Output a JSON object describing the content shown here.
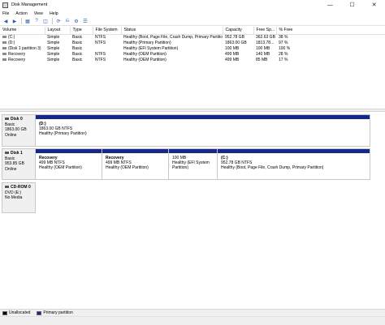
{
  "window": {
    "title": "Disk Management",
    "minimize": "—",
    "maximize": "☐",
    "close": "✕"
  },
  "menu": [
    "File",
    "Action",
    "View",
    "Help"
  ],
  "toolbar": [
    "back-icon",
    "forward-icon",
    "volume-list-icon",
    "help-icon",
    "disk-properties-icon",
    "refresh-icon",
    "rescan-icon",
    "settings-icon",
    "properties-icon"
  ],
  "table": {
    "headers": [
      "Volume",
      "Layout",
      "Type",
      "File System",
      "Status",
      "Capacity",
      "Free Sp...",
      "% Free"
    ],
    "rows": [
      [
        "(C:)",
        "Simple",
        "Basic",
        "NTFS",
        "Healthy (Boot, Page File, Crash Dump, Primary Partition)",
        "952.78 GB",
        "362.63 GB",
        "38 %"
      ],
      [
        "(D:)",
        "Simple",
        "Basic",
        "NTFS",
        "Healthy (Primary Partition)",
        "1863.00 GB",
        "1813.78...",
        "97 %"
      ],
      [
        "(Disk 1 partition 3)",
        "Simple",
        "Basic",
        "",
        "Healthy (EFI System Partition)",
        "100 MB",
        "100 MB",
        "100 %"
      ],
      [
        "Recovery",
        "Simple",
        "Basic",
        "NTFS",
        "Healthy (OEM Partition)",
        "499 MB",
        "140 MB",
        "28 %"
      ],
      [
        "Recovery",
        "Simple",
        "Basic",
        "NTFS",
        "Healthy (OEM Partition)",
        "499 MB",
        "85 MB",
        "17 %"
      ]
    ]
  },
  "disks": [
    {
      "name": "Disk 0",
      "type": "Basic",
      "size": "1863.00 GB",
      "status": "Online",
      "partitions": [
        {
          "name": "(D:)",
          "line1": "1863.00 GB NTFS",
          "line2": "Healthy (Primary Partition)"
        }
      ]
    },
    {
      "name": "Disk 1",
      "type": "Basic",
      "size": "953.85 GB",
      "status": "Online",
      "partitions": [
        {
          "name": "Recovery",
          "line1": "499 MB NTFS",
          "line2": "Healthy (OEM Partition)"
        },
        {
          "name": "Recovery",
          "line1": "499 MB NTFS",
          "line2": "Healthy (OEM Partition)"
        },
        {
          "name": "",
          "line1": "100 MB",
          "line2": "Healthy (EFI System Partition)"
        },
        {
          "name": "(C:)",
          "line1": "952.78 GB NTFS",
          "line2": "Healthy (Boot, Page File, Crash Dump, Primary Partition)"
        }
      ]
    },
    {
      "name": "CD-ROM 0",
      "type": "DVD (E:)",
      "size": "",
      "status": "No Media"
    }
  ],
  "legend": [
    {
      "label": "Unallocated",
      "color": "#000000"
    },
    {
      "label": "Primary partition",
      "color": "#17288c"
    }
  ]
}
